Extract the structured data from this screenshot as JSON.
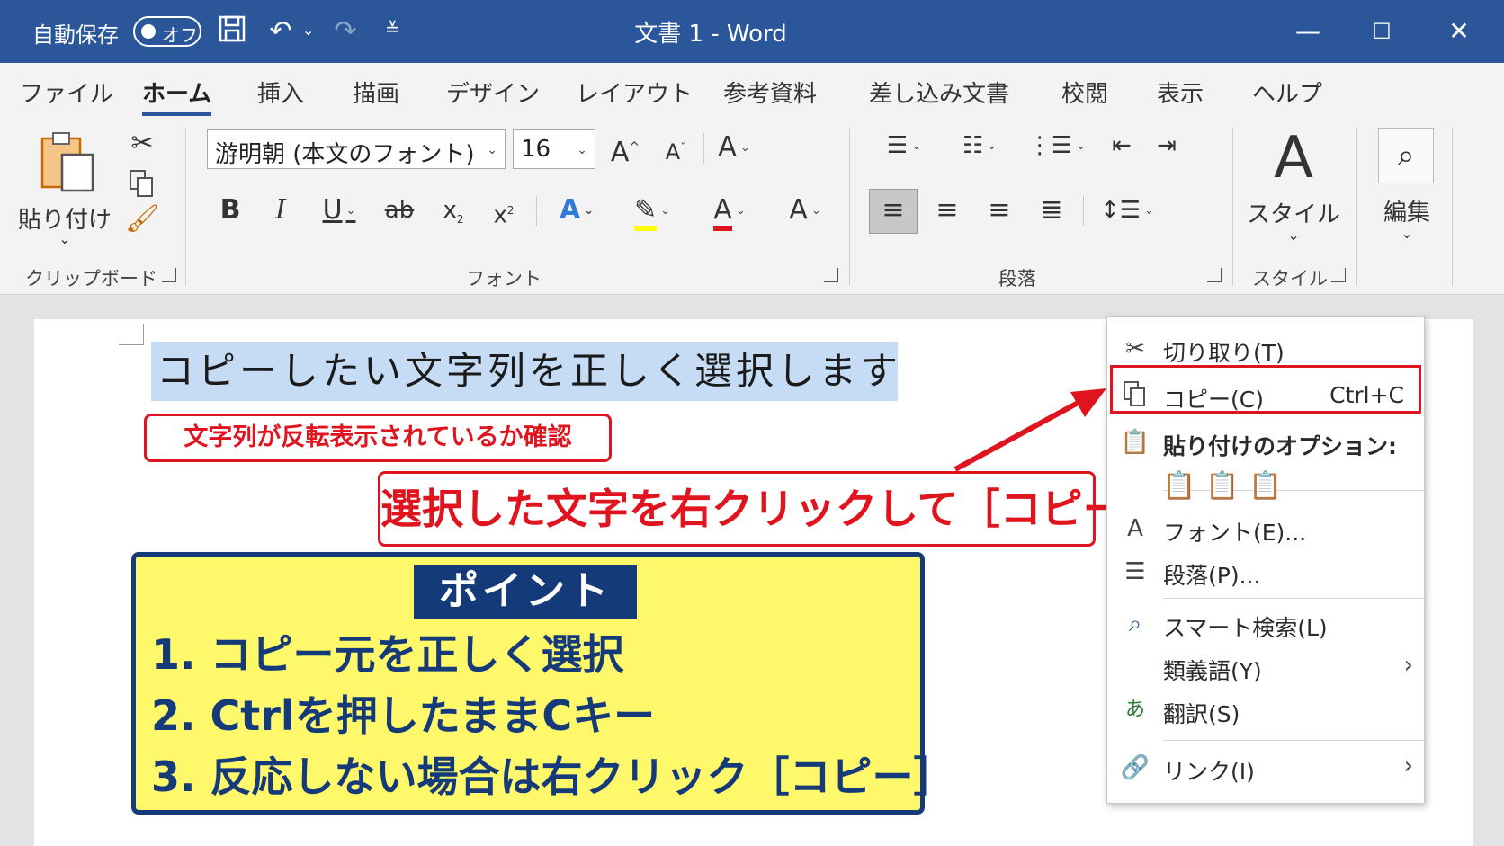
{
  "titlebar": {
    "autosave_label": "自動保存",
    "autosave_state": "オフ",
    "title": "文書 1  -  Word",
    "colors": {
      "bar": "#2b579a"
    }
  },
  "tabs": [
    "ファイル",
    "ホーム",
    "挿入",
    "描画",
    "デザイン",
    "レイアウト",
    "参考資料",
    "差し込み文書",
    "校閲",
    "表示",
    "ヘルプ"
  ],
  "ribbon": {
    "clipboard": {
      "paste_label": "貼り付け",
      "group_label": "クリップボード"
    },
    "font": {
      "font_name": "游明朝 (本文のフォント)",
      "font_size": "16",
      "group_label": "フォント"
    },
    "paragraph": {
      "group_label": "段落"
    },
    "styles": {
      "styles_label": "スタイル",
      "group_label": "スタイル"
    },
    "editing": {
      "label": "編集"
    }
  },
  "document": {
    "selected_text": "コピーしたい文字列を正しく選択します"
  },
  "annotations": {
    "check_note": "文字列が反転表示されているか確認",
    "action_note": "選択した文字を右クリックして［コピー］",
    "point_title": "ポイント",
    "points": [
      "1. コピー元を正しく選択",
      "2. Ctrlを押したままCキー",
      "3. 反応しない場合は右クリック［コピー］"
    ],
    "colors": {
      "red": "#e0141e",
      "navy": "#153a7a",
      "yellow": "#fff86a"
    }
  },
  "context_menu": {
    "cut": "切り取り(T)",
    "copy": "コピー(C)",
    "copy_shortcut": "Ctrl+C",
    "paste_options": "貼り付けのオプション:",
    "font": "フォント(E)...",
    "paragraph": "段落(P)...",
    "smart_lookup": "スマート検索(L)",
    "synonyms": "類義語(Y)",
    "translate": "翻訳(S)",
    "link": "リンク(I)"
  }
}
